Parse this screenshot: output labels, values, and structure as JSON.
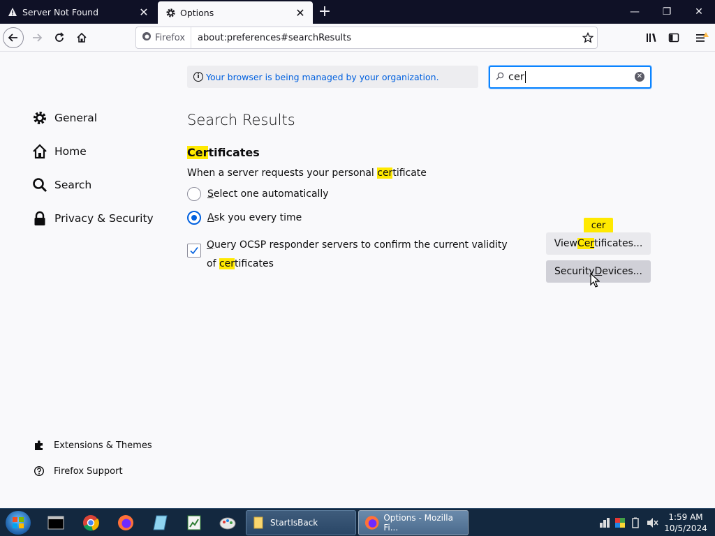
{
  "tabs": [
    {
      "title": "Server Not Found",
      "icon": "warning-icon",
      "close": "✕"
    },
    {
      "title": "Options",
      "icon": "gear-icon",
      "close": "✕"
    }
  ],
  "window_controls": {
    "minimize": "—",
    "restore": "❐",
    "close": "✕"
  },
  "urlbar": {
    "identity": "Firefox",
    "url": "about:preferences#searchResults"
  },
  "managed_notice": "Your browser is being managed by your organization.",
  "search": {
    "value": "cer"
  },
  "sidebar": {
    "items": [
      {
        "label": "General",
        "icon": "gear-icon"
      },
      {
        "label": "Home",
        "icon": "home-icon"
      },
      {
        "label": "Search",
        "icon": "search-icon"
      },
      {
        "label": "Privacy & Security",
        "icon": "lock-icon"
      }
    ],
    "footer": [
      {
        "label": "Extensions & Themes",
        "icon": "puzzle-icon"
      },
      {
        "label": "Firefox Support",
        "icon": "help-icon"
      }
    ]
  },
  "main": {
    "heading": "Search Results",
    "section": {
      "hl": "Cer",
      "rest": "tificates"
    },
    "description": {
      "pre": "When a server requests your personal ",
      "hl": "cer",
      "post": "tificate"
    },
    "radio_auto": {
      "accel": "S",
      "rest": "elect one automatically"
    },
    "radio_ask": {
      "accel": "A",
      "rest": "sk you every time"
    },
    "ocsp": {
      "accel": "Q",
      "line1": "uery OCSP responder servers to confirm the current validity of ",
      "hl": "cer",
      "post": "tificates"
    },
    "btn_view": {
      "pre": "View ",
      "hl": "Ce",
      "accel": "r",
      "post": "tificates..."
    },
    "btn_security": {
      "pre": "Security ",
      "accel": "D",
      "post": "evices..."
    },
    "tooltip": "cer"
  },
  "taskbar": {
    "tasks": [
      {
        "label": "StartIsBack"
      },
      {
        "label": "Options - Mozilla Fi..."
      }
    ],
    "clock": {
      "time": "1:59 AM",
      "date": "10/5/2024"
    }
  },
  "colors": {
    "accent": "#0060df",
    "highlight": "#ffe900",
    "focus": "#0a84ff"
  }
}
